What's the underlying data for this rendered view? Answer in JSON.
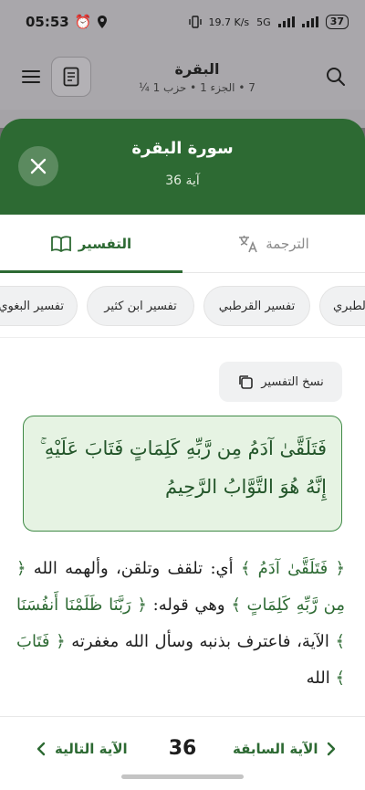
{
  "status_bar": {
    "time": "05:53",
    "speed": "19.7 K/s",
    "network": "5G",
    "battery": "37"
  },
  "app_bar": {
    "surah_name": "البقرة",
    "subtitle": "7 • الجزء 1 • حزب 1 ¼"
  },
  "sheet": {
    "title": "سورة البقرة",
    "ayah_label": "آية 36"
  },
  "tabs": {
    "translation": "الترجمة",
    "tafsir": "التفسير"
  },
  "chips": [
    "الطبري",
    "تفسير القرطبي",
    "تفسير ابن كثير",
    "تفسير البغوي"
  ],
  "copy_button": "نسخ التفسير",
  "verse": "فَتَلَقَّىٰ آدَمُ مِن رَّبِّهِ كَلِمَاتٍ فَتَابَ عَلَيْهِ ۚ إِنَّهُ هُوَ التَّوَّابُ الرَّحِيمُ",
  "tafsir": {
    "q1": "﴿ فَتَلَقَّىٰ آدَمُ ﴾",
    "t1": " أي: تلقف وتلقن، وألهمه الله ",
    "q2": "﴿ مِن رَّبِّهِ كَلِمَاتٍ ﴾",
    "t2": " وهي قوله: ",
    "q3": "﴿ رَبَّنَا ظَلَمْنَا أَنفُسَنَا ﴾",
    "t3": " الآية، فاعترف بذنبه وسأل الله مغفرته ",
    "q4": "﴿ فَتَابَ ﴾",
    "t4": " الله"
  },
  "bottom_nav": {
    "prev": "الآية السابقة",
    "number": "36",
    "next": "الآية التالية"
  },
  "colors": {
    "primary": "#2d6a33",
    "verse_bg": "#e6f3e3"
  }
}
